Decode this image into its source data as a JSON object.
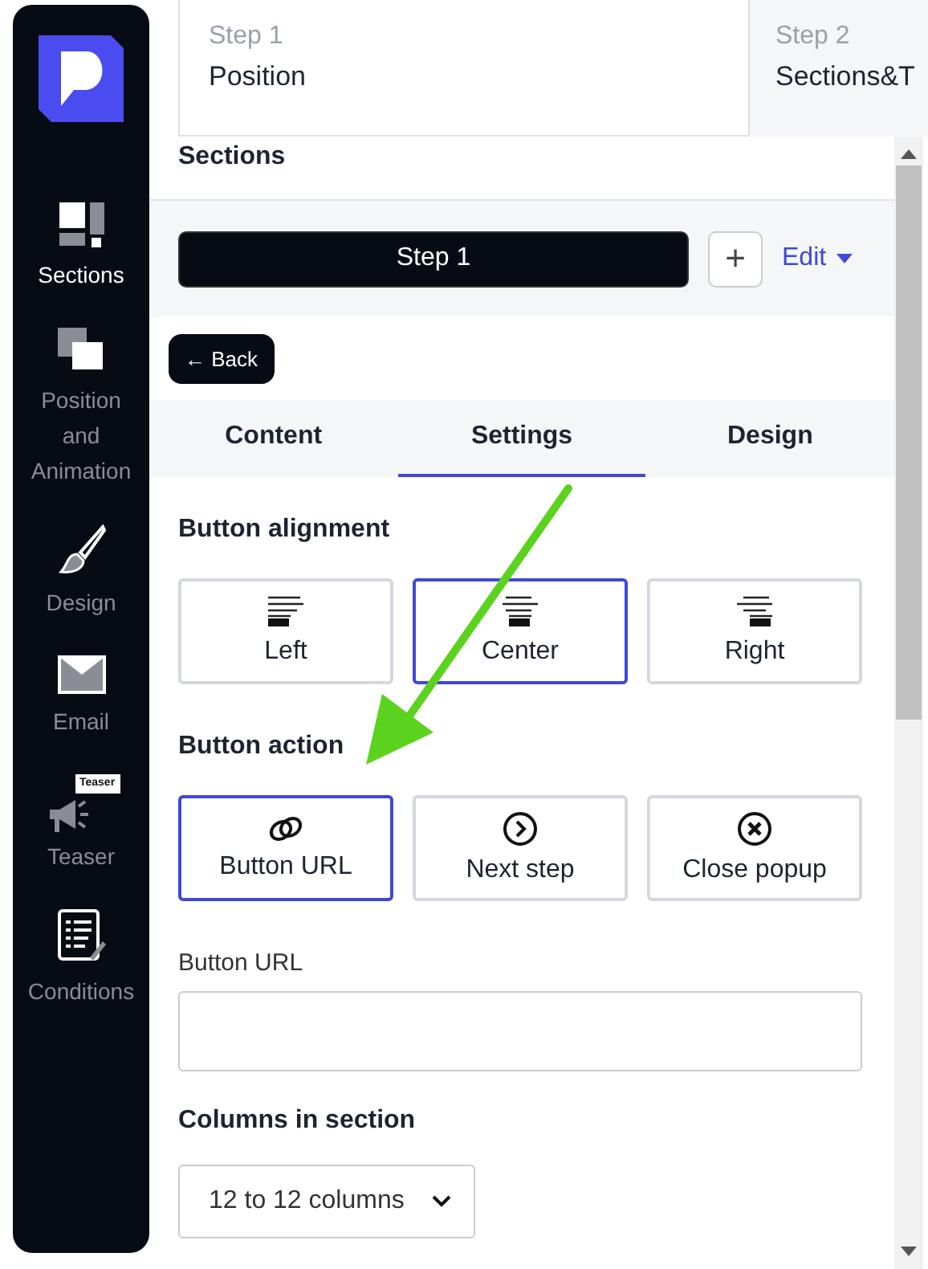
{
  "sidebar": {
    "items": [
      {
        "kind": "sections",
        "label": "Sections",
        "selected": true
      },
      {
        "kind": "position",
        "label": "Position and Animation",
        "selected": false
      },
      {
        "kind": "design",
        "label": "Design",
        "selected": false
      },
      {
        "kind": "email",
        "label": "Email",
        "selected": false
      },
      {
        "kind": "teaser",
        "label": "Teaser",
        "badge": "Teaser",
        "selected": false
      },
      {
        "kind": "conditions",
        "label": "Conditions",
        "selected": false
      }
    ]
  },
  "steps": [
    {
      "label": "Step 1",
      "title": "Position",
      "selected": true
    },
    {
      "label": "Step 2",
      "title": "Sections&T",
      "selected": false
    }
  ],
  "panel": {
    "title": "Sections",
    "section_button": "Step 1",
    "add_button": "+",
    "edit_link": "Edit",
    "back_button": "← Back"
  },
  "tabs": [
    {
      "label": "Content",
      "selected": false
    },
    {
      "label": "Settings",
      "selected": true
    },
    {
      "label": "Design",
      "selected": false
    }
  ],
  "alignment": {
    "title": "Button alignment",
    "options": [
      {
        "kind": "left",
        "label": "Left",
        "selected": false
      },
      {
        "kind": "center",
        "label": "Center",
        "selected": true
      },
      {
        "kind": "right",
        "label": "Right",
        "selected": false
      }
    ]
  },
  "action": {
    "title": "Button action",
    "options": [
      {
        "kind": "link",
        "label": "Button URL",
        "selected": true
      },
      {
        "kind": "next",
        "label": "Next step",
        "selected": false
      },
      {
        "kind": "close",
        "label": "Close popup",
        "selected": false
      }
    ]
  },
  "url_field": {
    "label": "Button URL"
  },
  "columns": {
    "title": "Columns in section",
    "value": "12 to 12 columns"
  }
}
